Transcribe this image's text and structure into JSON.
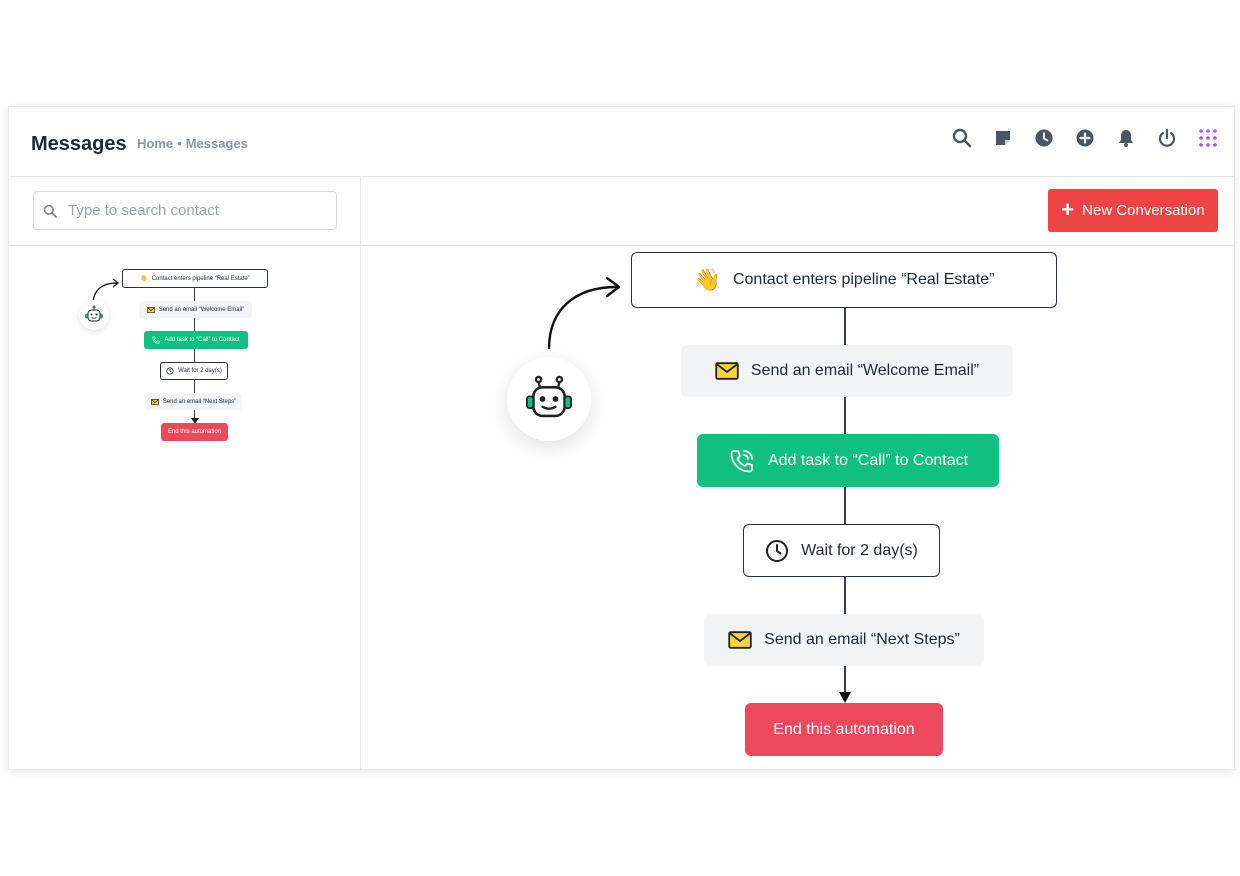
{
  "header": {
    "title": "Messages",
    "breadcrumb": {
      "home": "Home",
      "separator": "•",
      "current": "Messages"
    },
    "icons": [
      "search-icon",
      "note-icon",
      "clock-icon",
      "add-circle-icon",
      "bell-icon",
      "power-icon",
      "apps-grid-icon"
    ]
  },
  "sidebar": {
    "search": {
      "placeholder": "Type to search contact",
      "value": ""
    }
  },
  "main": {
    "new_conversation_label": "New Conversation"
  },
  "flow": {
    "trigger": {
      "emoji": "👋",
      "label": "Contact enters pipeline “Real Estate”"
    },
    "email1": {
      "label": "Send an email “Welcome Email”"
    },
    "task": {
      "label": "Add task to “Call” to Contact"
    },
    "wait": {
      "label": "Wait for 2 day(s)"
    },
    "email2": {
      "label": "Send an email “Next Steps”"
    },
    "end": {
      "label": "End this automation"
    }
  },
  "colors": {
    "primary_red": "#ef4444",
    "end_red": "#ec4a5c",
    "task_green": "#10c080",
    "grid_purple": "#a855f7",
    "robot_teal": "#10c080"
  }
}
